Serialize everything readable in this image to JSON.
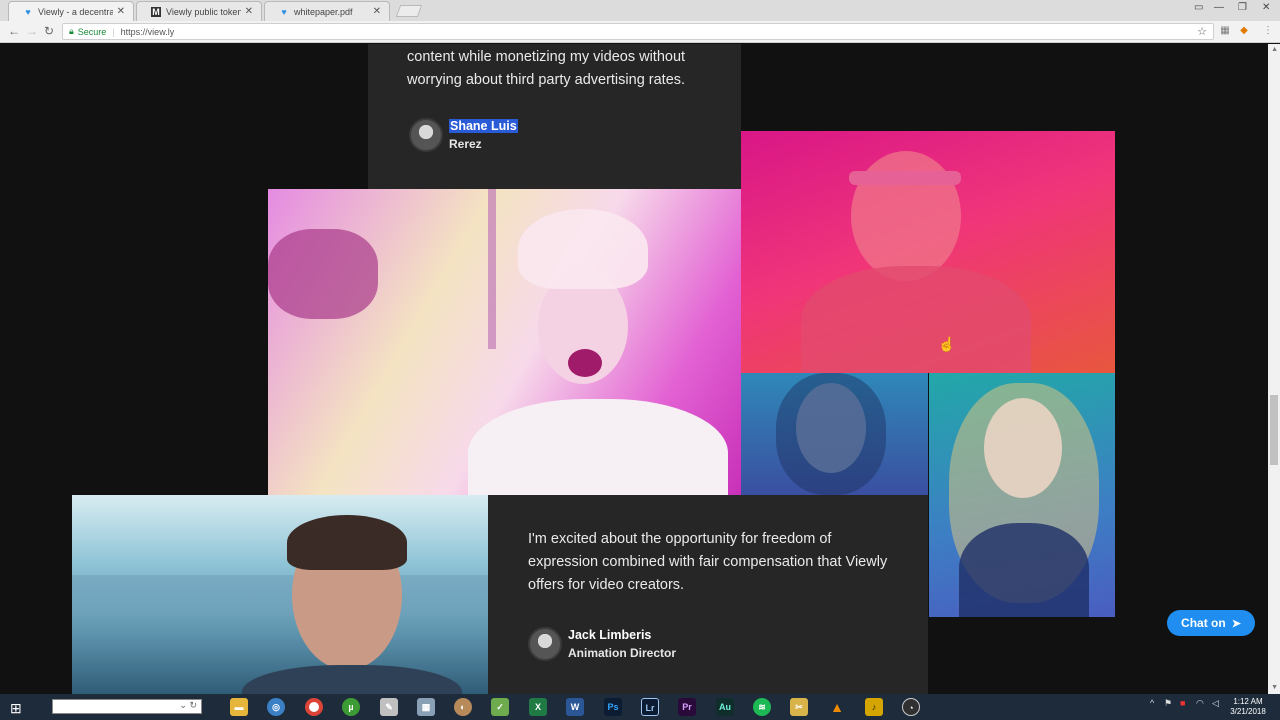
{
  "browser": {
    "tabs": [
      {
        "title": "Viewly - a decentralized",
        "favicon": "heart-icon",
        "active": true
      },
      {
        "title": "Viewly public token sale",
        "favicon": "medium-icon",
        "active": false
      },
      {
        "title": "whitepaper.pdf",
        "favicon": "heart-icon",
        "active": false
      }
    ],
    "secure_label": "Secure",
    "url": "https://view.ly"
  },
  "testimonials": [
    {
      "quote": "content while monetizing my videos without worrying about third party advertising rates.",
      "name": "Shane Luis",
      "role": "Rerez"
    },
    {
      "quote": "I'm excited about the opportunity for freedom of expression combined with fair compensation that Viewly offers for video creators.",
      "name": "Jack Limberis",
      "role": "Animation Director"
    }
  ],
  "chat_button": {
    "label": "Chat on",
    "icon": "telegram-icon"
  },
  "taskbar": {
    "apps": [
      "file-explorer-icon",
      "app-icon",
      "chrome-icon",
      "utorrent-icon",
      "paint-icon",
      "calculator-icon",
      "palette-icon",
      "notepad-icon",
      "excel-icon",
      "word-icon",
      "photoshop-icon",
      "lightroom-icon",
      "premiere-icon",
      "audition-icon",
      "spotify-icon",
      "tool-icon",
      "vlc-icon",
      "fl-studio-icon",
      "obs-icon"
    ],
    "app_labels": {
      "word": "W",
      "photoshop": "Ps",
      "lightroom": "Lr",
      "premiere": "Pr",
      "audition": "Au"
    },
    "time": "1:12 AM",
    "date": "3/21/2018"
  },
  "colors": {
    "page_bg": "#111111",
    "card_bg": "#262626",
    "selection": "#2a5bd7",
    "chat_button": "#1f8ef0",
    "taskbar": "#1e2b3a"
  }
}
